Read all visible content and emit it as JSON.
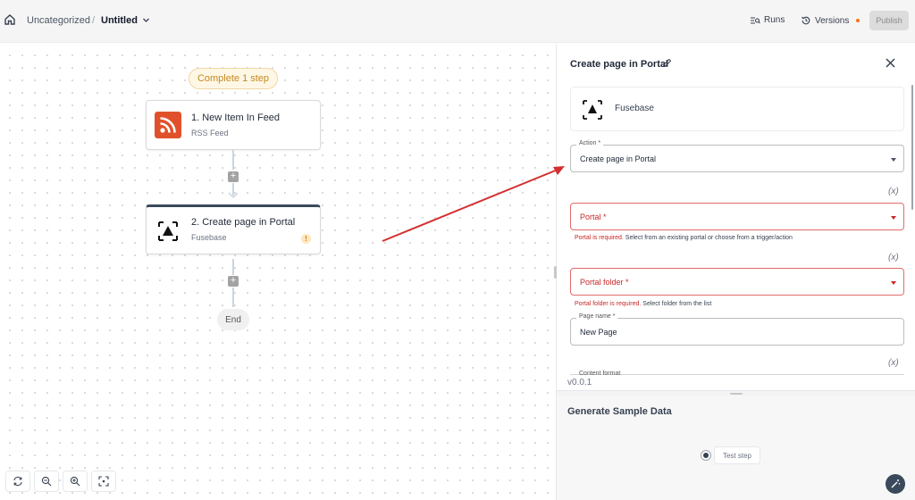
{
  "header": {
    "home_icon": "home-icon",
    "breadcrumb_folder": "Uncategorized",
    "breadcrumb_separator": "/",
    "flow_title": "Untitled",
    "runs_label": "Runs",
    "versions_label": "Versions",
    "publish_label": "Publish"
  },
  "canvas": {
    "status_pill": "Complete 1 step",
    "nodes": [
      {
        "title": "1. New Item In Feed",
        "subtitle": "RSS Feed",
        "icon": "rss-icon"
      },
      {
        "title": "2. Create page in Portal",
        "subtitle": "Fusebase",
        "icon": "fusebase-icon",
        "warning": "!"
      }
    ],
    "add_step_symbol": "+",
    "end_label": "End",
    "zoom_controls": [
      "reset-view-icon",
      "zoom-out-icon",
      "zoom-in-icon",
      "fit-view-icon"
    ]
  },
  "panel": {
    "title": "Create page in Portal",
    "piece_name": "Fusebase",
    "fields": {
      "action": {
        "label": "Action *",
        "value": "Create page in Portal"
      },
      "portal": {
        "value": "Portal *",
        "error_red": "Portal is required.",
        "error_rest": " Select from an existing portal or choose from a trigger/action"
      },
      "portal_folder": {
        "value": "Portal folder *",
        "error_red": "Portal folder is required.",
        "error_rest": " Select folder from the list"
      },
      "page_name": {
        "label": "Page name *",
        "value": "New Page"
      },
      "content_format": {
        "label": "Content format"
      }
    },
    "fx_label": "(x)",
    "version": "v0.0.1"
  },
  "sample": {
    "title": "Generate Sample Data",
    "test_step_label": "Test step"
  },
  "colors": {
    "accent_dark": "#3a4a5c",
    "error_red": "#c62828",
    "warning_orange": "#f97316",
    "rss_orange": "#e0512b"
  }
}
